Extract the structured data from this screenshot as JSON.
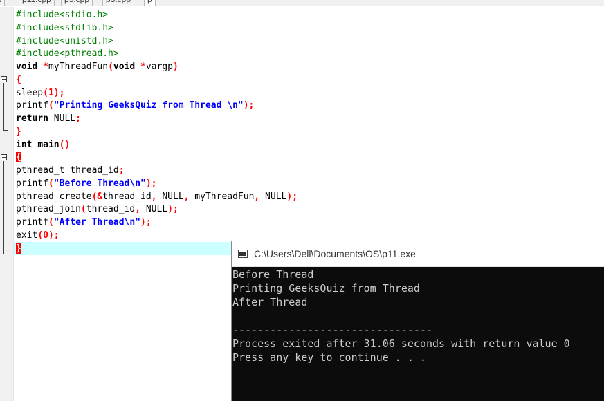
{
  "tabs": [
    {
      "label": "pp",
      "active": false
    },
    {
      "label": "p11.cpp",
      "active": false
    },
    {
      "label": "p5.cpp",
      "active": false
    },
    {
      "label": "p3.cpp",
      "active": false
    },
    {
      "label": "p",
      "active": true
    }
  ],
  "editor": {
    "lines": [
      [
        {
          "t": "#include<stdio.h>",
          "c": "pp"
        }
      ],
      [
        {
          "t": "#include<stdlib.h>",
          "c": "pp"
        }
      ],
      [
        {
          "t": "#include<unistd.h>",
          "c": "pp"
        }
      ],
      [
        {
          "t": "#include<pthread.h>",
          "c": "pp"
        }
      ],
      [
        {
          "t": "void",
          "c": "kw"
        },
        {
          "t": " ",
          "c": ""
        },
        {
          "t": "*",
          "c": "op"
        },
        {
          "t": "myThreadFun",
          "c": ""
        },
        {
          "t": "(",
          "c": "op"
        },
        {
          "t": "void",
          "c": "kw"
        },
        {
          "t": " ",
          "c": ""
        },
        {
          "t": "*",
          "c": "op"
        },
        {
          "t": "vargp",
          "c": ""
        },
        {
          "t": ")",
          "c": "op"
        }
      ],
      [
        {
          "t": "{",
          "c": "op"
        }
      ],
      [
        {
          "t": "sleep",
          "c": ""
        },
        {
          "t": "(",
          "c": "op"
        },
        {
          "t": "1",
          "c": "num"
        },
        {
          "t": ");",
          "c": "op"
        }
      ],
      [
        {
          "t": "printf",
          "c": ""
        },
        {
          "t": "(",
          "c": "op"
        },
        {
          "t": "\"Printing GeeksQuiz from Thread \\n\"",
          "c": "str"
        },
        {
          "t": ");",
          "c": "op"
        }
      ],
      [
        {
          "t": "return",
          "c": "kw"
        },
        {
          "t": " NULL",
          "c": ""
        },
        {
          "t": ";",
          "c": "op"
        }
      ],
      [
        {
          "t": "}",
          "c": "op"
        }
      ],
      [
        {
          "t": "int",
          "c": "kw"
        },
        {
          "t": " ",
          "c": ""
        },
        {
          "t": "main",
          "c": "kw"
        },
        {
          "t": "()",
          "c": "op"
        }
      ],
      [
        {
          "t": "{",
          "c": "hl"
        }
      ],
      [
        {
          "t": "pthread_t thread_id",
          "c": ""
        },
        {
          "t": ";",
          "c": "op"
        }
      ],
      [
        {
          "t": "printf",
          "c": ""
        },
        {
          "t": "(",
          "c": "op"
        },
        {
          "t": "\"Before Thread\\n\"",
          "c": "str"
        },
        {
          "t": ");",
          "c": "op"
        }
      ],
      [
        {
          "t": "pthread_create",
          "c": ""
        },
        {
          "t": "(&",
          "c": "op"
        },
        {
          "t": "thread_id",
          "c": ""
        },
        {
          "t": ",",
          "c": "op"
        },
        {
          "t": " NULL",
          "c": ""
        },
        {
          "t": ",",
          "c": "op"
        },
        {
          "t": " myThreadFun",
          "c": ""
        },
        {
          "t": ",",
          "c": "op"
        },
        {
          "t": " NULL",
          "c": ""
        },
        {
          "t": ");",
          "c": "op"
        }
      ],
      [
        {
          "t": "pthread_join",
          "c": ""
        },
        {
          "t": "(",
          "c": "op"
        },
        {
          "t": "thread_id",
          "c": ""
        },
        {
          "t": ",",
          "c": "op"
        },
        {
          "t": " NULL",
          "c": ""
        },
        {
          "t": ");",
          "c": "op"
        }
      ],
      [
        {
          "t": "printf",
          "c": ""
        },
        {
          "t": "(",
          "c": "op"
        },
        {
          "t": "\"After Thread\\n\"",
          "c": "str"
        },
        {
          "t": ");",
          "c": "op"
        }
      ],
      [
        {
          "t": "exit",
          "c": ""
        },
        {
          "t": "(",
          "c": "op"
        },
        {
          "t": "0",
          "c": "num"
        },
        {
          "t": ");",
          "c": "op"
        }
      ],
      [
        {
          "t": "}",
          "c": "hl"
        }
      ]
    ]
  },
  "console": {
    "title": "C:\\Users\\Dell\\Documents\\OS\\p11.exe",
    "output": [
      "Before Thread",
      "Printing GeeksQuiz from Thread",
      "After Thread",
      "",
      "--------------------------------",
      "Process exited after 31.06 seconds with return value 0",
      "Press any key to continue . . ."
    ]
  }
}
